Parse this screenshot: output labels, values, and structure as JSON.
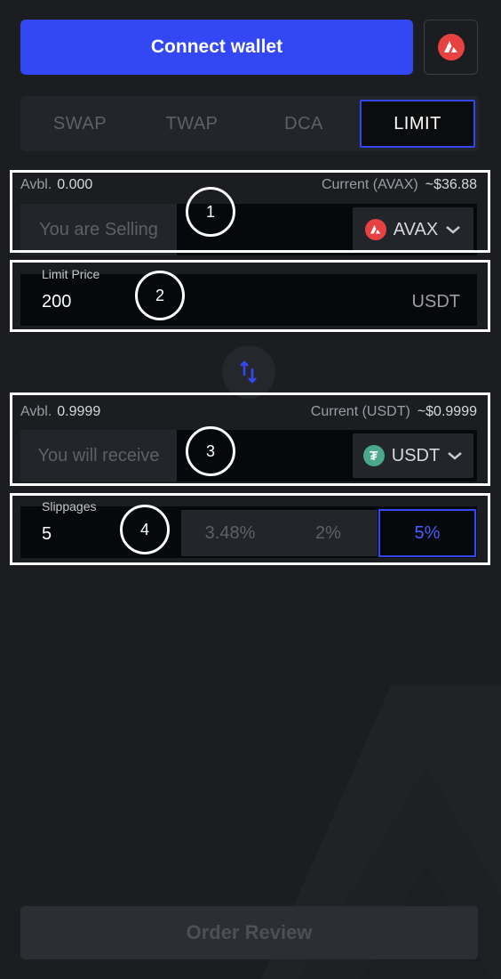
{
  "header": {
    "connect_label": "Connect wallet",
    "network_icon": "avax-logo-icon"
  },
  "tabs": [
    {
      "label": "SWAP",
      "active": false
    },
    {
      "label": "TWAP",
      "active": false
    },
    {
      "label": "DCA",
      "active": false
    },
    {
      "label": "LIMIT",
      "active": true
    }
  ],
  "sell": {
    "avbl_label": "Avbl.",
    "avbl_value": "0.000",
    "current_label": "Current (AVAX)",
    "current_value": "~$36.88",
    "placeholder": "You are Selling",
    "token": "AVAX"
  },
  "limit": {
    "label": "Limit Price",
    "value": "200",
    "unit": "USDT"
  },
  "receive": {
    "avbl_label": "Avbl.",
    "avbl_value": "0.9999",
    "current_label": "Current (USDT)",
    "current_value": "~$0.9999",
    "placeholder": "You will receive",
    "token": "USDT"
  },
  "slippage": {
    "label": "Slippages",
    "value": "5",
    "options": [
      {
        "label": "3.48%",
        "active": false
      },
      {
        "label": "2%",
        "active": false
      },
      {
        "label": "5%",
        "active": true
      }
    ]
  },
  "annotations": [
    "1",
    "2",
    "3",
    "4"
  ],
  "footer": {
    "order_label": "Order Review"
  },
  "colors": {
    "accent": "#3347f5",
    "avax": "#e84142",
    "usdt": "#4aa98a",
    "background": "#1b1d20"
  }
}
